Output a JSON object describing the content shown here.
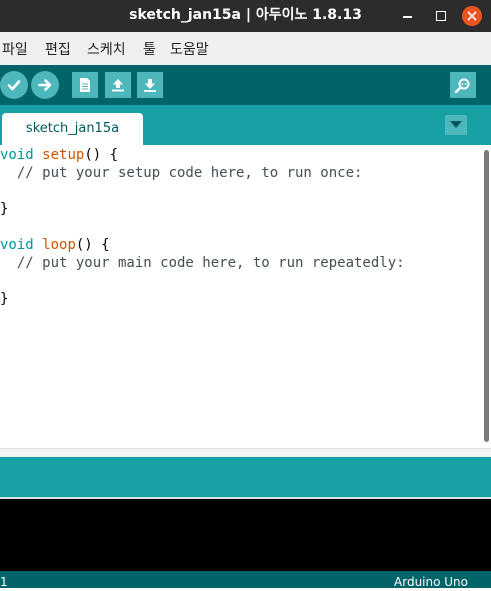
{
  "window": {
    "title": "sketch_jan15a | 아두이노 1.8.13"
  },
  "menu": [
    "파일",
    "편집",
    "스케치",
    "툴",
    "도움말"
  ],
  "tabs": [
    {
      "label": "sketch_jan15a"
    }
  ],
  "code": {
    "l1_kw": "void",
    "l1_fn": "setup",
    "l1_rest": "() {",
    "l2": "  // put your setup code here, to run once:",
    "l4": "}",
    "l6_kw": "void",
    "l6_fn": "loop",
    "l6_rest": "() {",
    "l7": "  // put your main code here, to run repeatedly:",
    "l9": "}"
  },
  "status": {
    "line": "1",
    "board": "Arduino Uno"
  },
  "colors": {
    "toolbar": "#006468",
    "tabstrip": "#17a1a5",
    "button": "#4db7bb",
    "keyword": "#00979c",
    "function": "#d35400",
    "console": "#000000"
  },
  "icons": [
    "verify-icon",
    "upload-icon",
    "new-icon",
    "open-icon",
    "save-icon",
    "serial-monitor-icon",
    "tab-menu-icon"
  ]
}
